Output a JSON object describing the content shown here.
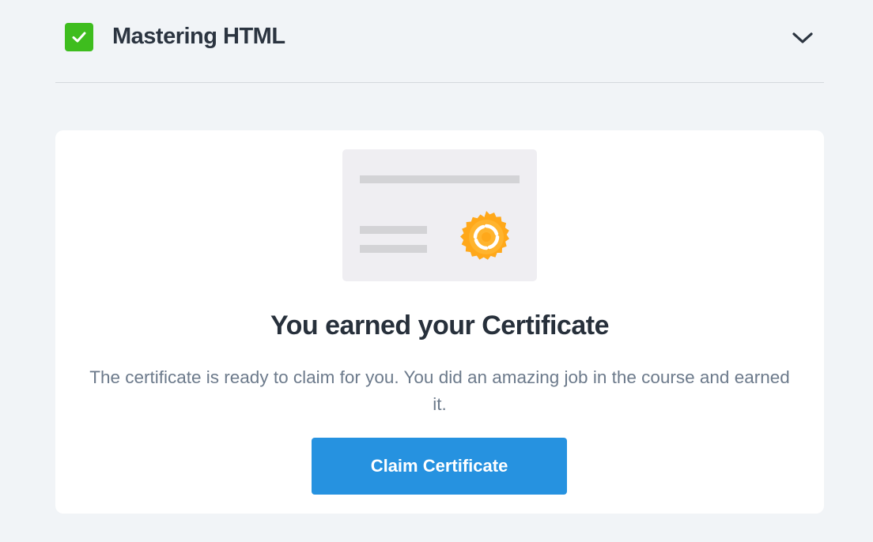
{
  "section": {
    "title": "Mastering HTML",
    "completed": true,
    "status_icon": "check-icon",
    "toggle_icon": "chevron-down-icon"
  },
  "certificate_card": {
    "illustration_icon": "certificate-icon",
    "seal_icon": "seal-badge-icon",
    "title": "You earned your Certificate",
    "description": "The certificate is ready to claim for you. You did an amazing job in the course and earned it.",
    "button_label": "Claim Certificate"
  },
  "colors": {
    "background": "#f1f4f7",
    "success_green": "#3ebd1e",
    "primary_blue": "#2692e0",
    "seal_orange": "#ffa81a",
    "title_text": "#27303b",
    "body_text": "#6c7a8b"
  }
}
